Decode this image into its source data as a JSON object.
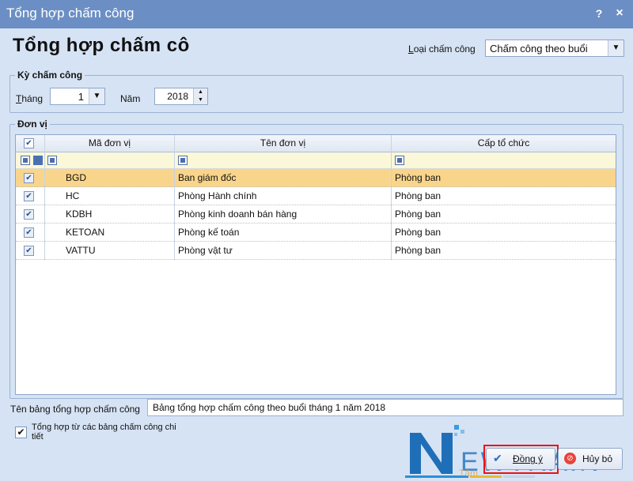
{
  "window": {
    "title": "Tổng hợp chấm công",
    "help_label": "?",
    "close_label": "×"
  },
  "heading": "Tổng hợp chấm cô",
  "type_select": {
    "label": "Loại chấm công",
    "value": "Chấm công theo buổi"
  },
  "period": {
    "group_title": "Kỳ chấm công",
    "month_label": "Tháng",
    "month_value": "1",
    "year_label": "Năm",
    "year_value": "2018"
  },
  "units": {
    "group_title": "Đơn vị",
    "columns": [
      "Mã đơn vị",
      "Tên đơn vị",
      "Cấp tổ chức"
    ],
    "rows": [
      {
        "code": "BGD",
        "name": "Ban giám đốc",
        "level": "Phòng ban",
        "checked": true
      },
      {
        "code": "HC",
        "name": "Phòng Hành chính",
        "level": "Phòng ban",
        "checked": true
      },
      {
        "code": "KDBH",
        "name": "Phòng kinh doanh bán hàng",
        "level": "Phòng ban",
        "checked": true
      },
      {
        "code": "KETOAN",
        "name": "Phòng kế toán",
        "level": "Phòng ban",
        "checked": true
      },
      {
        "code": "VATTU",
        "name": "Phòng vật tư",
        "level": "Phòng ban",
        "checked": true
      }
    ]
  },
  "summary_name": {
    "label": "Tên bảng tổng hợp chấm công",
    "value": "Bảng tổng hợp chấm công theo buổi tháng 1 năm 2018"
  },
  "detail_option": {
    "label_line1": "Tổng hợp từ các bảng chấm công chi",
    "label_line2": "tiết",
    "checked": true
  },
  "buttons": {
    "ok_label": "Đồng ý",
    "cancel_label": "Hủy bỏ"
  },
  "watermark": {
    "brand": "NEWTRAIN",
    "brand_left": "N",
    "brand_right": "EWTRAIN",
    "tagline": "Tâm"
  },
  "colors": {
    "titlebar": "#6b8fc4",
    "selected_row": "#f9d58c",
    "highlight_frame": "#ee1111",
    "brand_blue": "#1f6fb8"
  }
}
